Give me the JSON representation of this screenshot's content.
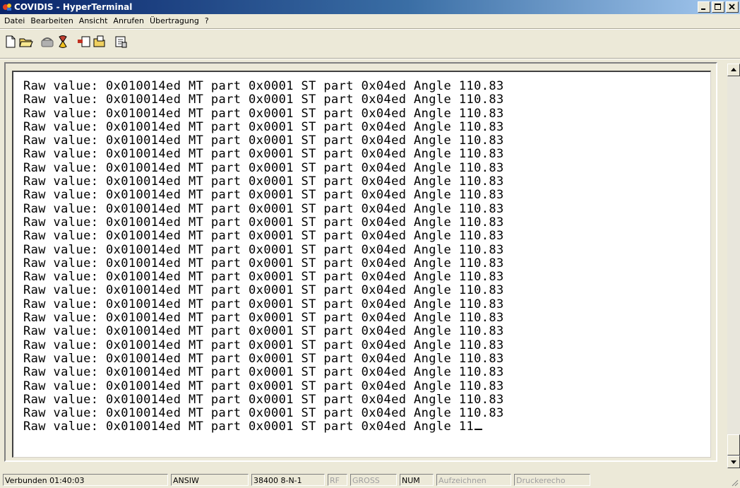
{
  "window": {
    "title": "COVIDIS - HyperTerminal",
    "icon": "hyperterminal-icon",
    "buttons": [
      "minimize-icon",
      "maximize-icon",
      "close-icon"
    ]
  },
  "menu": [
    "Datei",
    "Bearbeiten",
    "Ansicht",
    "Anrufen",
    "Übertragung",
    "?"
  ],
  "toolbar": [
    "new-document-icon",
    "open-folder-icon",
    "call-icon",
    "disconnect-icon",
    "send-icon",
    "receive-icon",
    "properties-icon"
  ],
  "terminal": {
    "lines": [
      "Raw value: 0x010014ed MT part 0x0001 ST part 0x04ed Angle 110.83",
      "Raw value: 0x010014ed MT part 0x0001 ST part 0x04ed Angle 110.83",
      "Raw value: 0x010014ed MT part 0x0001 ST part 0x04ed Angle 110.83",
      "Raw value: 0x010014ed MT part 0x0001 ST part 0x04ed Angle 110.83",
      "Raw value: 0x010014ed MT part 0x0001 ST part 0x04ed Angle 110.83",
      "Raw value: 0x010014ed MT part 0x0001 ST part 0x04ed Angle 110.83",
      "Raw value: 0x010014ed MT part 0x0001 ST part 0x04ed Angle 110.83",
      "Raw value: 0x010014ed MT part 0x0001 ST part 0x04ed Angle 110.83",
      "Raw value: 0x010014ed MT part 0x0001 ST part 0x04ed Angle 110.83",
      "Raw value: 0x010014ed MT part 0x0001 ST part 0x04ed Angle 110.83",
      "Raw value: 0x010014ed MT part 0x0001 ST part 0x04ed Angle 110.83",
      "Raw value: 0x010014ed MT part 0x0001 ST part 0x04ed Angle 110.83",
      "Raw value: 0x010014ed MT part 0x0001 ST part 0x04ed Angle 110.83",
      "Raw value: 0x010014ed MT part 0x0001 ST part 0x04ed Angle 110.83",
      "Raw value: 0x010014ed MT part 0x0001 ST part 0x04ed Angle 110.83",
      "Raw value: 0x010014ed MT part 0x0001 ST part 0x04ed Angle 110.83",
      "Raw value: 0x010014ed MT part 0x0001 ST part 0x04ed Angle 110.83",
      "Raw value: 0x010014ed MT part 0x0001 ST part 0x04ed Angle 110.83",
      "Raw value: 0x010014ed MT part 0x0001 ST part 0x04ed Angle 110.83",
      "Raw value: 0x010014ed MT part 0x0001 ST part 0x04ed Angle 110.83",
      "Raw value: 0x010014ed MT part 0x0001 ST part 0x04ed Angle 110.83",
      "Raw value: 0x010014ed MT part 0x0001 ST part 0x04ed Angle 110.83",
      "Raw value: 0x010014ed MT part 0x0001 ST part 0x04ed Angle 110.83",
      "Raw value: 0x010014ed MT part 0x0001 ST part 0x04ed Angle 110.83",
      "Raw value: 0x010014ed MT part 0x0001 ST part 0x04ed Angle 110.83",
      "Raw value: 0x010014ed MT part 0x0001 ST part 0x04ed Angle 11"
    ]
  },
  "status": {
    "connection": "Verbunden 01:40:03",
    "emulation": "ANSIW",
    "port_settings": "38400 8-N-1",
    "scroll": "RF",
    "caps": "GROSS",
    "num": "NUM",
    "capture": "Aufzeichnen",
    "print_echo": "Druckerecho"
  }
}
